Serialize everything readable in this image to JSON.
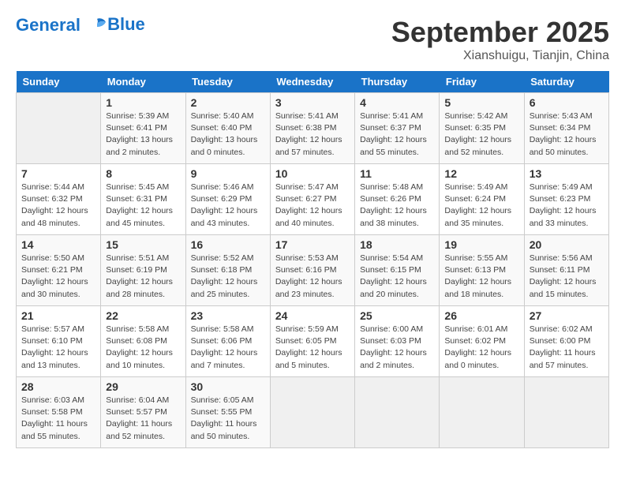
{
  "header": {
    "logo_line1": "General",
    "logo_line2": "Blue",
    "month": "September 2025",
    "location": "Xianshuigu, Tianjin, China"
  },
  "days_of_week": [
    "Sunday",
    "Monday",
    "Tuesday",
    "Wednesday",
    "Thursday",
    "Friday",
    "Saturday"
  ],
  "weeks": [
    [
      {
        "num": "",
        "info": ""
      },
      {
        "num": "1",
        "info": "Sunrise: 5:39 AM\nSunset: 6:41 PM\nDaylight: 13 hours\nand 2 minutes."
      },
      {
        "num": "2",
        "info": "Sunrise: 5:40 AM\nSunset: 6:40 PM\nDaylight: 13 hours\nand 0 minutes."
      },
      {
        "num": "3",
        "info": "Sunrise: 5:41 AM\nSunset: 6:38 PM\nDaylight: 12 hours\nand 57 minutes."
      },
      {
        "num": "4",
        "info": "Sunrise: 5:41 AM\nSunset: 6:37 PM\nDaylight: 12 hours\nand 55 minutes."
      },
      {
        "num": "5",
        "info": "Sunrise: 5:42 AM\nSunset: 6:35 PM\nDaylight: 12 hours\nand 52 minutes."
      },
      {
        "num": "6",
        "info": "Sunrise: 5:43 AM\nSunset: 6:34 PM\nDaylight: 12 hours\nand 50 minutes."
      }
    ],
    [
      {
        "num": "7",
        "info": "Sunrise: 5:44 AM\nSunset: 6:32 PM\nDaylight: 12 hours\nand 48 minutes."
      },
      {
        "num": "8",
        "info": "Sunrise: 5:45 AM\nSunset: 6:31 PM\nDaylight: 12 hours\nand 45 minutes."
      },
      {
        "num": "9",
        "info": "Sunrise: 5:46 AM\nSunset: 6:29 PM\nDaylight: 12 hours\nand 43 minutes."
      },
      {
        "num": "10",
        "info": "Sunrise: 5:47 AM\nSunset: 6:27 PM\nDaylight: 12 hours\nand 40 minutes."
      },
      {
        "num": "11",
        "info": "Sunrise: 5:48 AM\nSunset: 6:26 PM\nDaylight: 12 hours\nand 38 minutes."
      },
      {
        "num": "12",
        "info": "Sunrise: 5:49 AM\nSunset: 6:24 PM\nDaylight: 12 hours\nand 35 minutes."
      },
      {
        "num": "13",
        "info": "Sunrise: 5:49 AM\nSunset: 6:23 PM\nDaylight: 12 hours\nand 33 minutes."
      }
    ],
    [
      {
        "num": "14",
        "info": "Sunrise: 5:50 AM\nSunset: 6:21 PM\nDaylight: 12 hours\nand 30 minutes."
      },
      {
        "num": "15",
        "info": "Sunrise: 5:51 AM\nSunset: 6:19 PM\nDaylight: 12 hours\nand 28 minutes."
      },
      {
        "num": "16",
        "info": "Sunrise: 5:52 AM\nSunset: 6:18 PM\nDaylight: 12 hours\nand 25 minutes."
      },
      {
        "num": "17",
        "info": "Sunrise: 5:53 AM\nSunset: 6:16 PM\nDaylight: 12 hours\nand 23 minutes."
      },
      {
        "num": "18",
        "info": "Sunrise: 5:54 AM\nSunset: 6:15 PM\nDaylight: 12 hours\nand 20 minutes."
      },
      {
        "num": "19",
        "info": "Sunrise: 5:55 AM\nSunset: 6:13 PM\nDaylight: 12 hours\nand 18 minutes."
      },
      {
        "num": "20",
        "info": "Sunrise: 5:56 AM\nSunset: 6:11 PM\nDaylight: 12 hours\nand 15 minutes."
      }
    ],
    [
      {
        "num": "21",
        "info": "Sunrise: 5:57 AM\nSunset: 6:10 PM\nDaylight: 12 hours\nand 13 minutes."
      },
      {
        "num": "22",
        "info": "Sunrise: 5:58 AM\nSunset: 6:08 PM\nDaylight: 12 hours\nand 10 minutes."
      },
      {
        "num": "23",
        "info": "Sunrise: 5:58 AM\nSunset: 6:06 PM\nDaylight: 12 hours\nand 7 minutes."
      },
      {
        "num": "24",
        "info": "Sunrise: 5:59 AM\nSunset: 6:05 PM\nDaylight: 12 hours\nand 5 minutes."
      },
      {
        "num": "25",
        "info": "Sunrise: 6:00 AM\nSunset: 6:03 PM\nDaylight: 12 hours\nand 2 minutes."
      },
      {
        "num": "26",
        "info": "Sunrise: 6:01 AM\nSunset: 6:02 PM\nDaylight: 12 hours\nand 0 minutes."
      },
      {
        "num": "27",
        "info": "Sunrise: 6:02 AM\nSunset: 6:00 PM\nDaylight: 11 hours\nand 57 minutes."
      }
    ],
    [
      {
        "num": "28",
        "info": "Sunrise: 6:03 AM\nSunset: 5:58 PM\nDaylight: 11 hours\nand 55 minutes."
      },
      {
        "num": "29",
        "info": "Sunrise: 6:04 AM\nSunset: 5:57 PM\nDaylight: 11 hours\nand 52 minutes."
      },
      {
        "num": "30",
        "info": "Sunrise: 6:05 AM\nSunset: 5:55 PM\nDaylight: 11 hours\nand 50 minutes."
      },
      {
        "num": "",
        "info": ""
      },
      {
        "num": "",
        "info": ""
      },
      {
        "num": "",
        "info": ""
      },
      {
        "num": "",
        "info": ""
      }
    ]
  ]
}
